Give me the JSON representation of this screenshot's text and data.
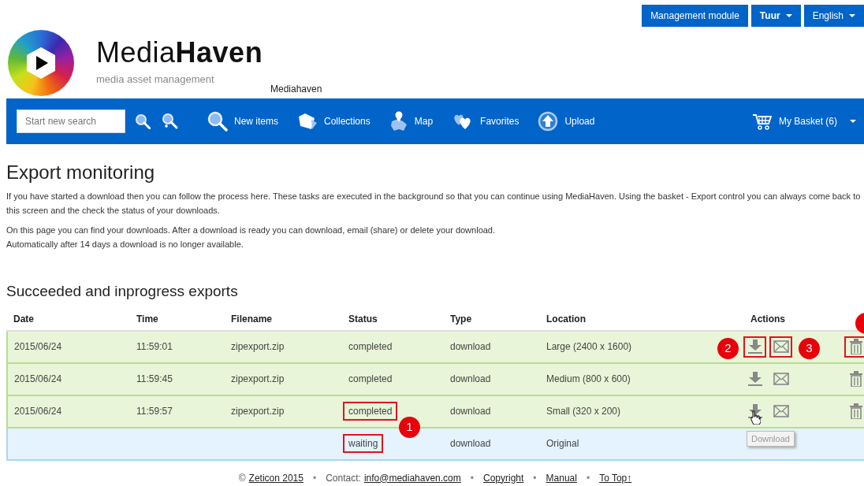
{
  "top_buttons": [
    {
      "label": "Management module",
      "bold": false,
      "dropdown": false
    },
    {
      "label": "Tuur",
      "bold": true,
      "dropdown": true
    },
    {
      "label": "English",
      "bold": false,
      "dropdown": true
    }
  ],
  "logo": {
    "title": "Media**Haven**",
    "tagline": "media asset management"
  },
  "site_label": "Mediahaven",
  "navbar": {
    "search": {
      "placeholder": "Start new search"
    },
    "items": [
      {
        "kind": "new-items",
        "label": "New items"
      },
      {
        "kind": "collections",
        "label": "Collections"
      },
      {
        "kind": "map",
        "label": "Map"
      },
      {
        "kind": "favorites",
        "label": "Favorites"
      },
      {
        "kind": "upload",
        "label": "Upload"
      }
    ],
    "basket": {
      "label": "My Basket (6)"
    }
  },
  "page": {
    "title": "Export monitoring",
    "paragraphs": [
      {
        "lines": [
          "If you have started a download then you can follow the process here. These tasks are executed in the background so that you can continue using MediaHaven. Using the basket - Export control you can always come back to this screen and the check the status of your downloads."
        ]
      },
      {
        "lines": [
          "On this page you can find your downloads. After a download is ready you can download, email (share) or delete your download.",
          "Automatically after 14 days a download is no longer available."
        ]
      }
    ]
  },
  "exports": {
    "title": "Succeeded and inprogress exports",
    "columns": [
      "Date",
      "Time",
      "Filename",
      "Status",
      "Type",
      "Location",
      "Actions"
    ],
    "rows": [
      {
        "kind": "done",
        "date": "2015/06/24",
        "time": "11:59:01",
        "filename": "zipexport.zip",
        "status": "completed",
        "type": "download",
        "location": "Large (2400 x 1600)",
        "status_highlighted": false,
        "actions_highlighted": true,
        "download_callout": "2",
        "email_callout": "3",
        "delete_callout_cut": true,
        "pointer": false
      },
      {
        "kind": "done",
        "date": "2015/06/24",
        "time": "11:59:45",
        "filename": "zipexport.zip",
        "status": "completed",
        "type": "download",
        "location": "Medium (800 x 600)",
        "status_highlighted": false,
        "actions_highlighted": false,
        "delete_callout_cut": false,
        "pointer": false
      },
      {
        "kind": "done",
        "date": "2015/06/24",
        "time": "11:59:57",
        "filename": "zipexport.zip",
        "status": "completed",
        "type": "download",
        "location": "Small (320 x 200)",
        "status_highlighted": true,
        "actions_highlighted": false,
        "status_callout": "1",
        "delete_callout_cut": false,
        "pointer": true,
        "tooltip": "Download"
      },
      {
        "kind": "pending",
        "status": "waiting",
        "type": "download",
        "location": "Original",
        "status_highlighted": true
      }
    ]
  },
  "footer": [
    {
      "prefix": "©",
      "link": "Zeticon 2015"
    },
    {
      "separator": "•",
      "prefix": "Contact:",
      "link": "info@mediahaven.com"
    },
    {
      "separator": "•",
      "link": "Copyright"
    },
    {
      "separator": "•",
      "link": "Manual"
    },
    {
      "separator": "•",
      "link": "To Top↑"
    }
  ]
}
